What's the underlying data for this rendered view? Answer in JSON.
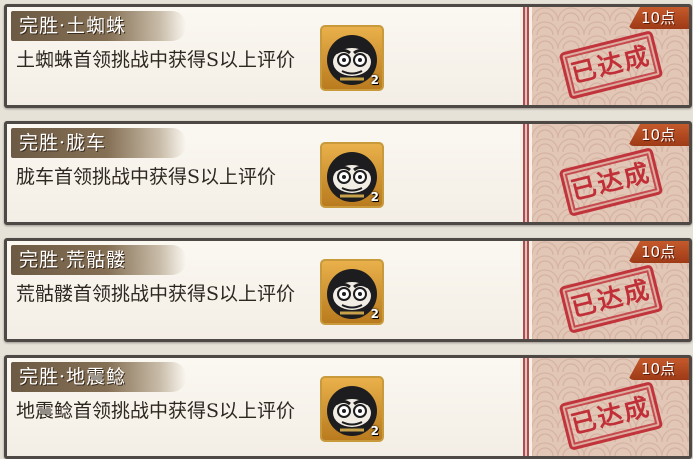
{
  "challenges": [
    {
      "title": "完胜·土蜘蛛",
      "description": "土蜘蛛首领挑战中获得S以上评价",
      "reward_icon": "daruma-icon",
      "reward_count": "2",
      "points": "10点",
      "status": "已达成"
    },
    {
      "title": "完胜·胧车",
      "description": "胧车首领挑战中获得S以上评价",
      "reward_icon": "daruma-icon",
      "reward_count": "2",
      "points": "10点",
      "status": "已达成"
    },
    {
      "title": "完胜·荒骷髅",
      "description": "荒骷髅首领挑战中获得S以上评价",
      "reward_icon": "daruma-icon",
      "reward_count": "2",
      "points": "10点",
      "status": "已达成"
    },
    {
      "title": "完胜·地震鲶",
      "description": "地震鲶首领挑战中获得S以上评价",
      "reward_icon": "daruma-icon",
      "reward_count": "2",
      "points": "10点",
      "status": "已达成"
    }
  ],
  "colors": {
    "accent_red": "#be232d",
    "points_tag": "#b3481f",
    "item_frame": "#c89a3c"
  }
}
